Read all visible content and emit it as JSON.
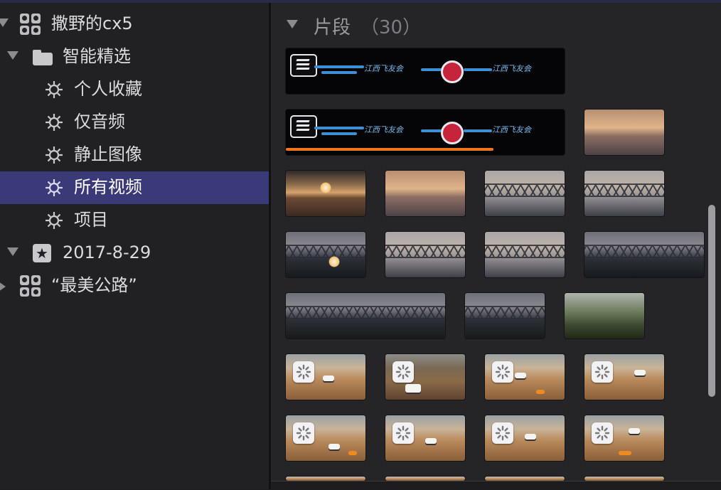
{
  "sidebar": {
    "items": [
      {
        "label": "撒野的cx5",
        "icon": "library-grid-icon",
        "disclosure": "expanded"
      },
      {
        "label": "智能精选",
        "icon": "folder-icon",
        "disclosure": "expanded"
      },
      {
        "label": "个人收藏",
        "icon": "gear-icon"
      },
      {
        "label": "仅音频",
        "icon": "gear-icon"
      },
      {
        "label": "静止图像",
        "icon": "gear-icon"
      },
      {
        "label": "所有视频",
        "icon": "gear-icon",
        "selected": true
      },
      {
        "label": "项目",
        "icon": "gear-icon"
      },
      {
        "label": "2017-8-29",
        "icon": "event-star-icon",
        "disclosure": "expanded"
      },
      {
        "label": "“最美公路”",
        "icon": "library-grid-icon",
        "disclosure": "collapsed"
      }
    ]
  },
  "browser": {
    "section_title": "片段",
    "section_count": "（30）"
  },
  "colors": {
    "selection": "#3a3a78",
    "progress": "#f0761e",
    "background": "#252527"
  }
}
